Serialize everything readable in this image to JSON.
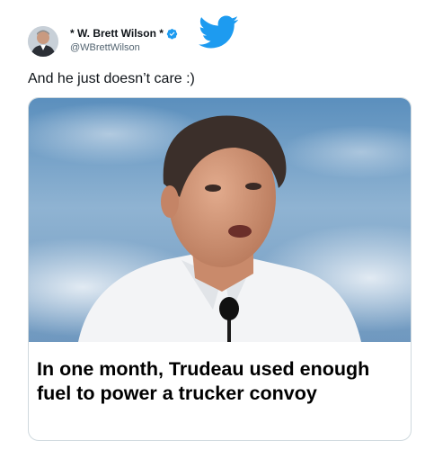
{
  "tweet": {
    "author_name": "* W. Brett Wilson *",
    "author_handle": "@WBrettWilson",
    "text": "And he just doesn’t care :)"
  },
  "card": {
    "headline": "In one month, Trudeau used enough fuel to power a trucker convoy"
  },
  "colors": {
    "twitter_blue": "#1d9bf0",
    "text_primary": "#0f1419",
    "text_secondary": "#536471",
    "card_border": "#cfd9de"
  },
  "icons": {
    "logo": "twitter-bird-icon",
    "verified": "verified-badge-icon"
  }
}
